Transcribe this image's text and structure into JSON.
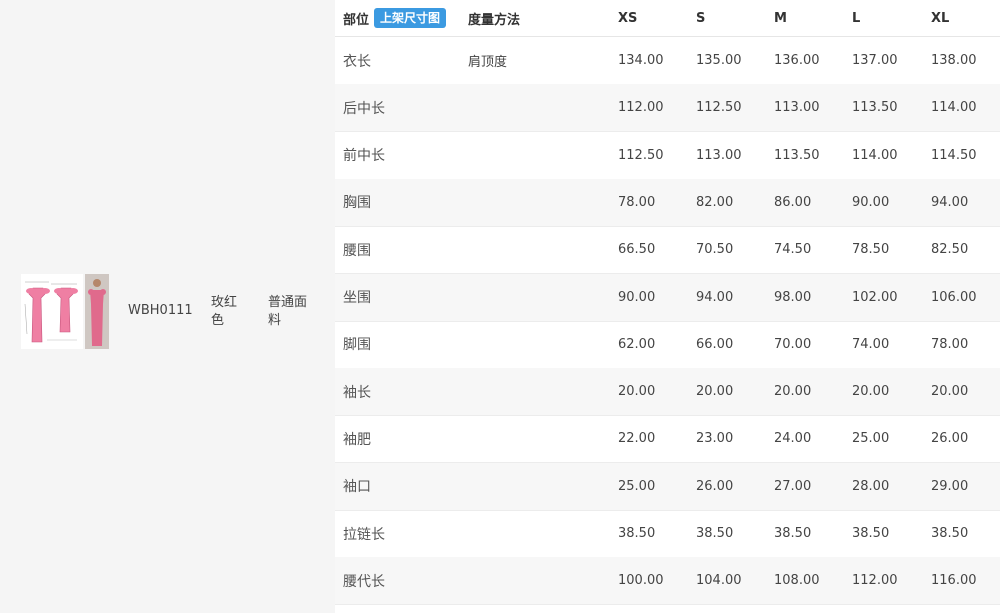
{
  "product": {
    "code": "WBH0111",
    "color": "玫红色",
    "fabric": "普通面料",
    "sketch_color": "#ef7fa3",
    "photo_color": "#e06a8c"
  },
  "table": {
    "headers": {
      "part": "部位",
      "badge": "上架尺寸图",
      "method": "度量方法",
      "sizes": [
        "XS",
        "S",
        "M",
        "L",
        "XL"
      ]
    },
    "rows": [
      {
        "part": "衣长",
        "method": "肩顶度",
        "values": [
          "134.00",
          "135.00",
          "136.00",
          "137.00",
          "138.00"
        ]
      },
      {
        "part": "后中长",
        "method": "",
        "values": [
          "112.00",
          "112.50",
          "113.00",
          "113.50",
          "114.00"
        ]
      },
      {
        "part": "前中长",
        "method": "",
        "values": [
          "112.50",
          "113.00",
          "113.50",
          "114.00",
          "114.50"
        ]
      },
      {
        "part": "胸围",
        "method": "",
        "values": [
          "78.00",
          "82.00",
          "86.00",
          "90.00",
          "94.00"
        ]
      },
      {
        "part": "腰围",
        "method": "",
        "values": [
          "66.50",
          "70.50",
          "74.50",
          "78.50",
          "82.50"
        ]
      },
      {
        "part": "坐围",
        "method": "",
        "values": [
          "90.00",
          "94.00",
          "98.00",
          "102.00",
          "106.00"
        ]
      },
      {
        "part": "脚围",
        "method": "",
        "values": [
          "62.00",
          "66.00",
          "70.00",
          "74.00",
          "78.00"
        ]
      },
      {
        "part": "袖长",
        "method": "",
        "values": [
          "20.00",
          "20.00",
          "20.00",
          "20.00",
          "20.00"
        ]
      },
      {
        "part": "袖肥",
        "method": "",
        "values": [
          "22.00",
          "23.00",
          "24.00",
          "25.00",
          "26.00"
        ]
      },
      {
        "part": "袖口",
        "method": "",
        "values": [
          "25.00",
          "26.00",
          "27.00",
          "28.00",
          "29.00"
        ]
      },
      {
        "part": "拉链长",
        "method": "",
        "values": [
          "38.50",
          "38.50",
          "38.50",
          "38.50",
          "38.50"
        ]
      },
      {
        "part": "腰代长",
        "method": "",
        "values": [
          "100.00",
          "104.00",
          "108.00",
          "112.00",
          "116.00"
        ]
      }
    ]
  }
}
